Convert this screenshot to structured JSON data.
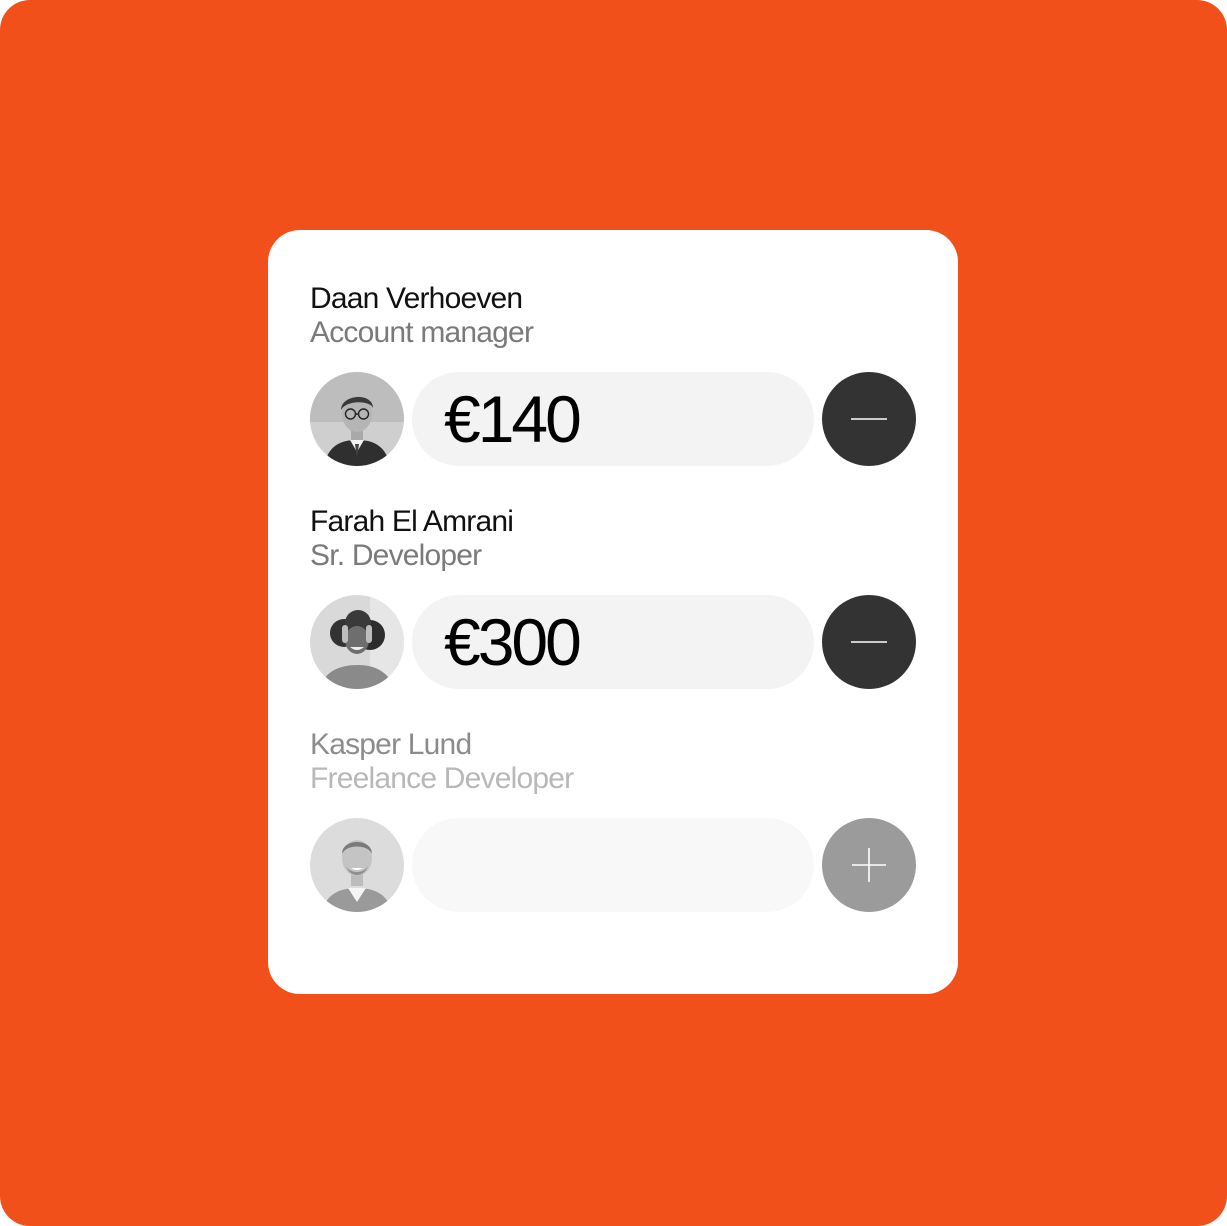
{
  "theme": {
    "background": "#f2501a",
    "card": "#ffffff",
    "button_active": "#333333",
    "button_disabled": "#9b9b9b",
    "field": "#f3f3f3"
  },
  "people": [
    {
      "name": "Daan Verhoeven",
      "role": "Account manager",
      "amount": "€140",
      "action_icon": "minus-icon",
      "state": "selected"
    },
    {
      "name": "Farah El Amrani",
      "role": "Sr. Developer",
      "amount": "€300",
      "action_icon": "minus-icon",
      "state": "selected"
    },
    {
      "name": "Kasper Lund",
      "role": "Freelance Developer",
      "amount": "",
      "action_icon": "plus-icon",
      "state": "unselected"
    }
  ]
}
